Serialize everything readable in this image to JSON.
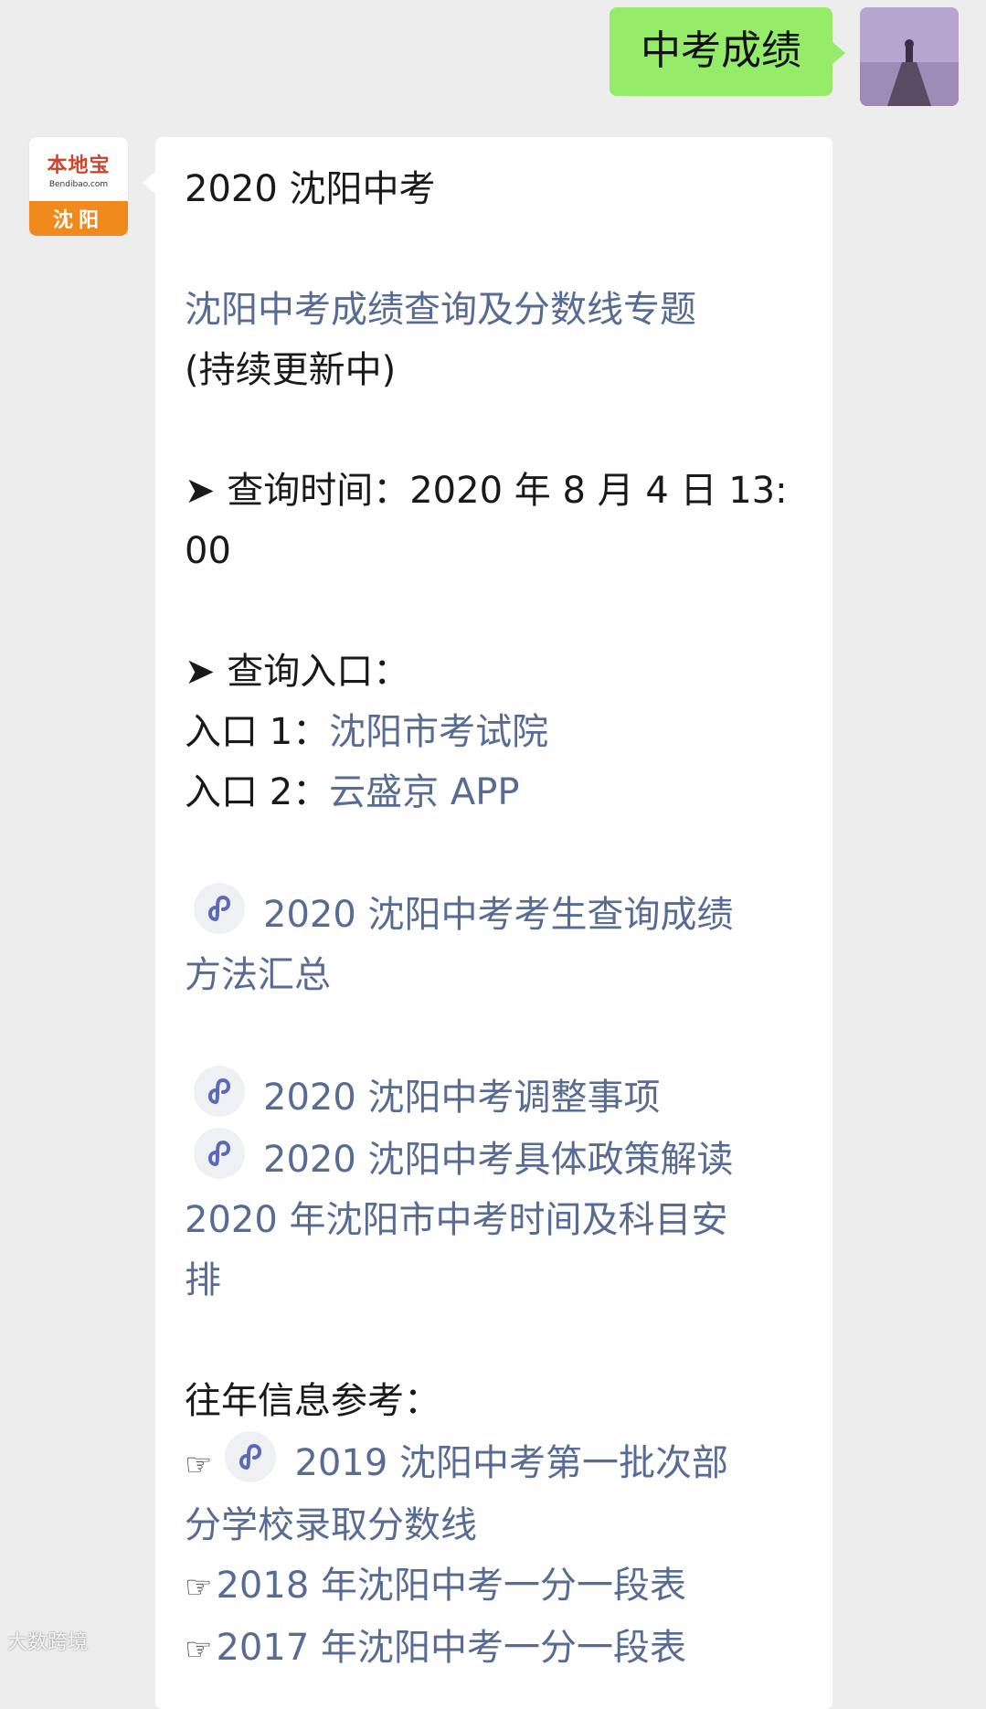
{
  "sent_message": {
    "text": "中考成绩"
  },
  "bot": {
    "logo_name": "本地宝",
    "logo_url": "Bendibao.com",
    "logo_city": "沈阳"
  },
  "reply": {
    "title": "2020 沈阳中考",
    "topic_link": "沈阳中考成绩查询及分数线专题",
    "topic_note": "(持续更新中)",
    "arrow": "➤",
    "query_time_line1": "查询时间：2020 年 8 月 4 日 13:",
    "query_time_line2": "00",
    "entry_heading": "查询入口：",
    "entry1_label": "入口 1：",
    "entry1_link": "沈阳市考试院",
    "entry2_label": "入口 2：",
    "entry2_link": "云盛京 APP",
    "link_methods_line1": "2020 沈阳中考考生查询成绩",
    "link_methods_line2": "方法汇总",
    "link_adjust": "2020 沈阳中考调整事项",
    "link_policy": "2020 沈阳中考具体政策解读",
    "link_schedule_line1": "2020 年沈阳市中考时间及科目安",
    "link_schedule_line2": "排",
    "past_heading": "往年信息参考：",
    "hand": "☞",
    "link_2019_line1": "2019 沈阳中考第一批次部",
    "link_2019_line2": "分学校录取分数线",
    "link_2018": "2018 年沈阳中考一分一段表",
    "link_2017": "2017 年沈阳中考一分一段表"
  },
  "watermark": "大数跨境",
  "colors": {
    "sent_bubble": "#95ec69",
    "link": "#576b95",
    "background": "#ededed",
    "logo_orange": "#f08a1c"
  }
}
